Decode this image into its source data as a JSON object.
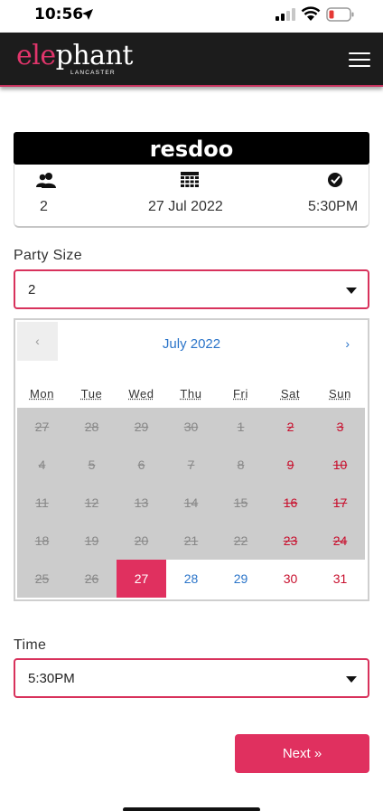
{
  "status_bar": {
    "time": "10:56"
  },
  "header": {
    "logo_el": "ele",
    "logo_rest": "phant",
    "logo_sub": "LANCASTER"
  },
  "booking": {
    "brand": "resdoo",
    "party_value": "2",
    "date_value": "27 Jul 2022",
    "time_value": "5:30PM"
  },
  "party_size": {
    "label": "Party Size",
    "selected": "2"
  },
  "calendar": {
    "prev_label": "‹",
    "next_label": "›",
    "month_title": "July 2022",
    "days_of_week": [
      "Mon",
      "Tue",
      "Wed",
      "Thu",
      "Fri",
      "Sat",
      "Sun"
    ],
    "weeks": [
      [
        "27",
        "28",
        "29",
        "30",
        "1",
        "2",
        "3"
      ],
      [
        "4",
        "5",
        "6",
        "7",
        "8",
        "9",
        "10"
      ],
      [
        "11",
        "12",
        "13",
        "14",
        "15",
        "16",
        "17"
      ],
      [
        "18",
        "19",
        "20",
        "21",
        "22",
        "23",
        "24"
      ],
      [
        "25",
        "26",
        "27",
        "28",
        "29",
        "30",
        "31"
      ]
    ],
    "selected_day": "27",
    "unavailable_note": "greyed dates unavailable"
  },
  "time_field": {
    "label": "Time",
    "selected": "5:30PM"
  },
  "next_button": {
    "label": "Next »"
  },
  "colors": {
    "accent": "#e0305f",
    "link": "#2a74c9",
    "weekend": "#c8102e"
  }
}
